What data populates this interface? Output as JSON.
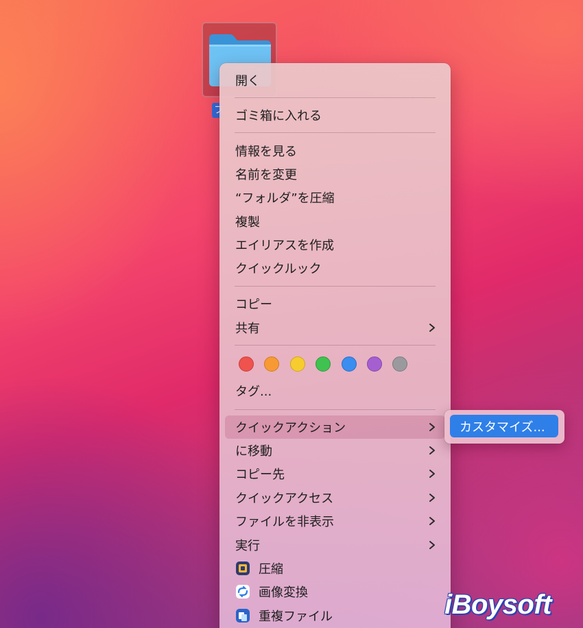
{
  "desktop": {
    "folder_label": "フ"
  },
  "menu": {
    "open": "開く",
    "trash": "ゴミ箱に入れる",
    "get_info": "情報を見る",
    "rename": "名前を変更",
    "compress": "“フォルダ”を圧縮",
    "duplicate": "複製",
    "make_alias": "エイリアスを作成",
    "quick_look": "クイックルック",
    "copy": "コピー",
    "share": "共有",
    "tags": "タグ...",
    "quick_actions": "クイックアクション",
    "move_to": "に移動",
    "copy_to": "コピー先",
    "quick_access": "クイックアクセス",
    "hide_files": "ファイルを非表示",
    "run": "実行",
    "app_compress": "圧縮",
    "image_convert": "画像変換",
    "duplicate_files": "重複ファイル"
  },
  "tag_colors": [
    "#f0524d",
    "#f89a33",
    "#f7cc2e",
    "#3fc24f",
    "#3b8df0",
    "#a65fd0",
    "#9a9a9e"
  ],
  "submenu": {
    "customize": "カスタマイズ..."
  },
  "watermark": "iBoysoft"
}
